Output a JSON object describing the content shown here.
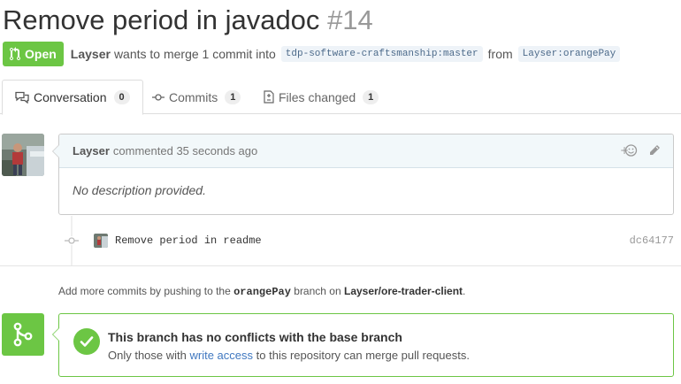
{
  "pr": {
    "title": "Remove period in javadoc",
    "number": "#14",
    "state": "Open",
    "author": "Layser",
    "merge_text": "wants to merge 1 commit into",
    "base_ref": "tdp-software-craftsmanship:master",
    "from_text": "from",
    "head_ref": "Layser:orangePay"
  },
  "tabs": [
    {
      "label": "Conversation",
      "count": "0",
      "icon": "comment-discussion-icon"
    },
    {
      "label": "Commits",
      "count": "1",
      "icon": "git-commit-icon"
    },
    {
      "label": "Files changed",
      "count": "1",
      "icon": "file-diff-icon"
    }
  ],
  "comment": {
    "author": "Layser",
    "action": "commented 35 seconds ago",
    "body": "No description provided.",
    "reaction_icon": "smiley-add-icon",
    "edit_icon": "pencil-icon"
  },
  "commit": {
    "message": "Remove period in readme",
    "sha": "dc64177"
  },
  "hint": {
    "prefix": "Add more commits by pushing to the",
    "branch": "orangePay",
    "middle": "branch on",
    "repo": "Layser/ore-trader-client",
    "suffix": "."
  },
  "merge": {
    "title": "This branch has no conflicts with the base branch",
    "sub_prefix": "Only those with",
    "sub_link": "write access",
    "sub_suffix": "to this repository can merge pull requests."
  },
  "colors": {
    "open_green": "#6cc644",
    "link_blue": "#4078c0"
  }
}
